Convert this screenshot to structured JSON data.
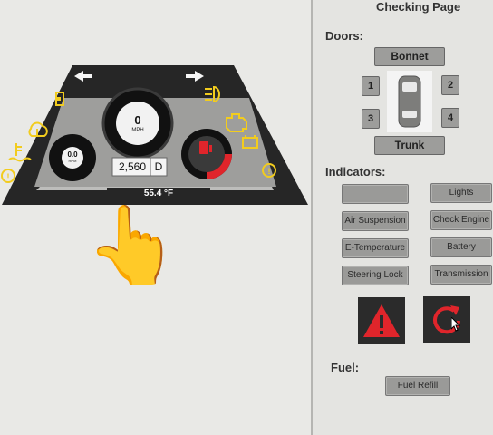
{
  "header": {
    "title": "Checking Page"
  },
  "doors": {
    "label": "Doors:",
    "bonnet": "Bonnet",
    "trunk": "Trunk",
    "door_numbers": [
      "1",
      "2",
      "3",
      "4"
    ]
  },
  "indicators": {
    "label": "Indicators:",
    "buttons": [
      "",
      "Lights",
      "Air Suspension",
      "Check Engine",
      "E-Temperature",
      "Battery",
      "Steering Lock",
      "Transmission"
    ]
  },
  "warning_tiles": {
    "icons": [
      "warning-triangle-icon",
      "reset-arrow-icon"
    ]
  },
  "fuel": {
    "label": "Fuel:",
    "refill": "Fuel Refill"
  },
  "dashboard": {
    "speed_value": "0",
    "speed_unit": "MPH",
    "rpm_value": "0.0",
    "rpm_unit": "RPM",
    "odometer": "2,560",
    "gear": "D",
    "temperature": "55.4 °F",
    "fuel_level": 0.25,
    "colors": {
      "panel": "#262626",
      "warning": "#f2cc1e",
      "fuel_red": "#e0252b",
      "tile_red": "#e0252b"
    }
  },
  "pointer": {
    "icon": "pointing-hand-icon",
    "glyph": "👆"
  }
}
